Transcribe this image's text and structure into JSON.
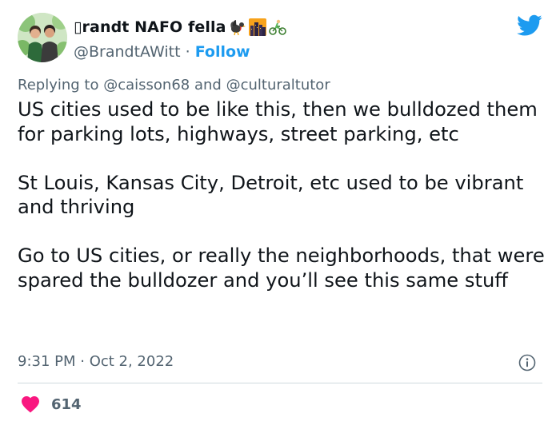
{
  "author": {
    "display_name": "▯randt NAFO fella",
    "handle": "@BrandtAWitt",
    "separator": "·",
    "follow_label": "Follow",
    "emojis": [
      "turkey-emoji",
      "city-night-emoji",
      "cyclist-emoji"
    ]
  },
  "reply_context": {
    "prefix": "Replying to",
    "user1": "@caisson68",
    "conjunction": "and",
    "user2": "@culturaltutor"
  },
  "tweet": {
    "paragraphs": [
      "US cities used to be like this, then we bulldozed them for parking lots, highways, street parking, etc",
      "St Louis, Kansas City, Detroit, etc used to be vibrant and thriving",
      "Go to US cities, or really the neighborhoods, that were spared the bulldozer and you’ll see this same stuff"
    ],
    "timestamp": "9:31 PM · Oct 2, 2022"
  },
  "engagement": {
    "likes": "614"
  },
  "icons": {
    "brand": "twitter-bird-icon",
    "info": "info-icon",
    "like": "heart-icon"
  },
  "colors": {
    "brand_blue": "#1d9bf0",
    "heart_red": "#f91880",
    "secondary_text": "#536471",
    "primary_text": "#0f1419",
    "divider": "#cfd9de"
  }
}
